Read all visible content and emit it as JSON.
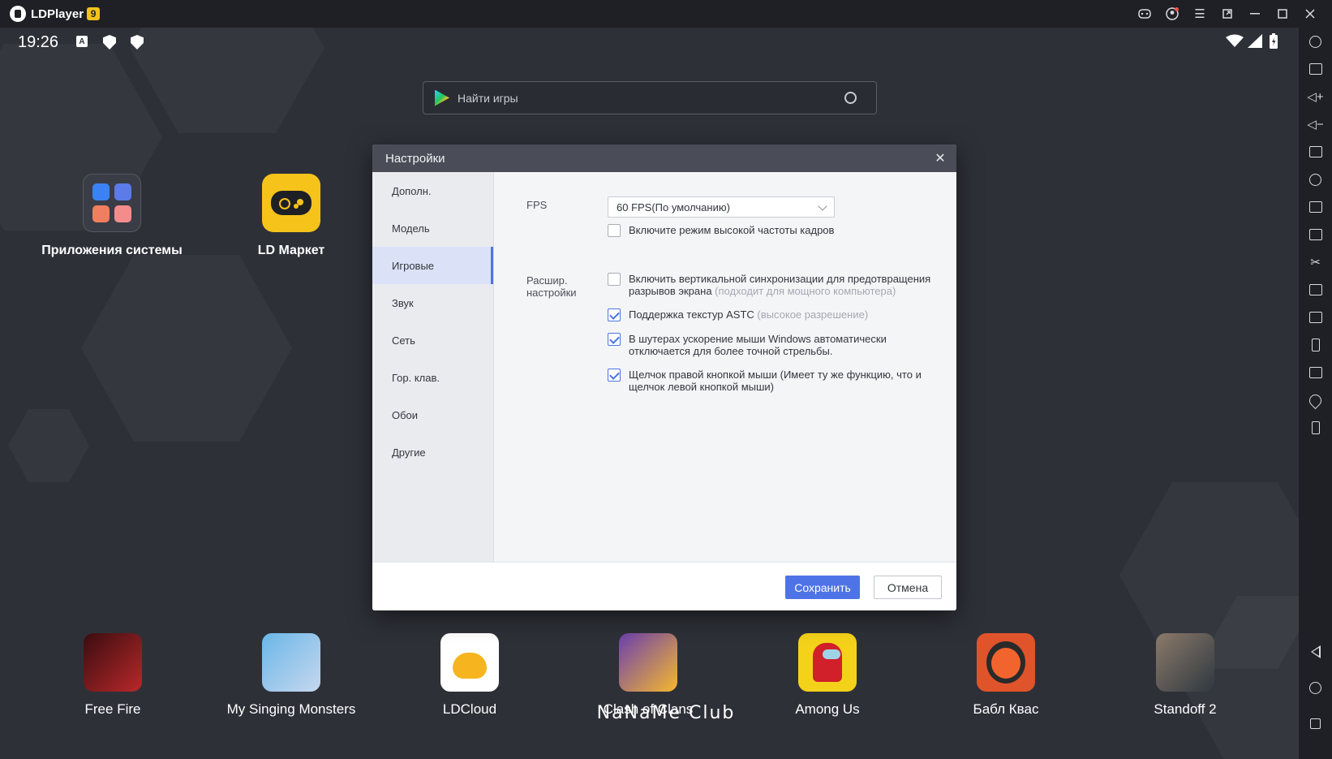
{
  "window": {
    "app_name": "LDPlayer",
    "version_badge": "9"
  },
  "statusbar": {
    "time": "19:26",
    "a_label": "A"
  },
  "search": {
    "placeholder": "Найти игры"
  },
  "desktop": {
    "apps": [
      {
        "label": "Приложения системы",
        "icon": "system-apps-folder-icon"
      },
      {
        "label": "LD Маркет",
        "icon": "gamepad-icon"
      }
    ]
  },
  "dock": {
    "apps": [
      {
        "label": "Free Fire",
        "color": "#b8282a"
      },
      {
        "label": "My Singing Monsters",
        "color": "#6ab7e8"
      },
      {
        "label": "LDCloud",
        "color": "#f6b51e"
      },
      {
        "label": "Clash of Clans",
        "color": "#6b3fb0"
      },
      {
        "label": "Among Us",
        "color": "#f4d21a"
      },
      {
        "label": "Бабл Квас",
        "color": "#e0542b"
      },
      {
        "label": "Standoff 2",
        "color": "#5b6a7a"
      }
    ]
  },
  "watermark": "NaNaMe Club",
  "settings": {
    "title": "Настройки",
    "nav": [
      "Дополн.",
      "Модель",
      "Игровые",
      "Звук",
      "Сеть",
      "Гор. клав.",
      "Обои",
      "Другие"
    ],
    "active_nav": "Игровые",
    "fps_label": "FPS",
    "fps_value": "60 FPS(По умолчанию)",
    "high_fps": {
      "text": "Включите режим высокой частоты кадров",
      "checked": false
    },
    "advanced_label_1": "Расшир.",
    "advanced_label_2": "настройки",
    "options": [
      {
        "text": "Включить вертикальной синхронизации для предотвращения разрывов экрана",
        "hint": "(подходит для мощного компьютера)",
        "checked": false
      },
      {
        "text": "Поддержка текстур ASTC",
        "hint": "(высокое разрешение)",
        "checked": true
      },
      {
        "text": "В шутерах ускорение мыши Windows автоматически отключается для более точной стрельбы.",
        "hint": "",
        "checked": true
      },
      {
        "text": "Щелчок правой кнопкой мыши (Имеет ту же функцию, что и щелчок левой кнопкой мыши)",
        "hint": "",
        "checked": true
      }
    ],
    "save_label": "Сохранить",
    "cancel_label": "Отмена"
  },
  "colors": {
    "accent": "#4e73e6",
    "titlebar": "#1f2025",
    "ldmarket": "#f6c31a"
  }
}
